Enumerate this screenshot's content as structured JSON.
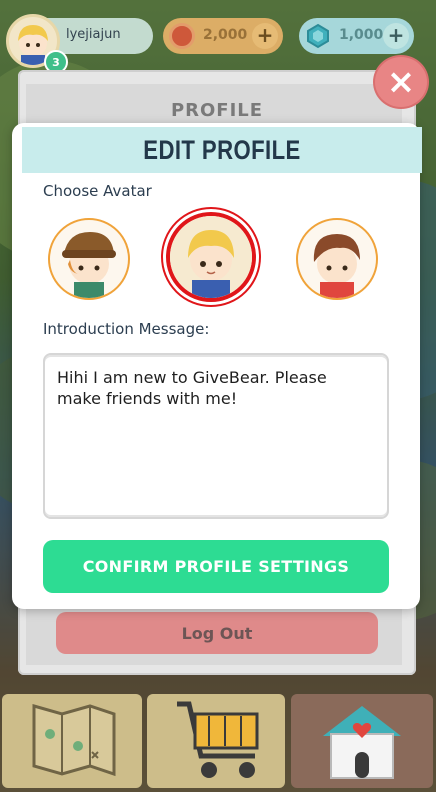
{
  "topbar": {
    "username": "lyejiajun",
    "level": "3",
    "coins": "2,000",
    "gems": "1,000",
    "plus_label": "+",
    "coin_icon": "coin-icon",
    "gem_icon": "gem-icon"
  },
  "profile_panel": {
    "title": "PROFILE",
    "logout_label": "Log Out"
  },
  "modal": {
    "title": "EDIT PROFILE",
    "choose_avatar_label": "Choose Avatar",
    "avatars": [
      {
        "name": "avatar-hat-boy",
        "selected": false
      },
      {
        "name": "avatar-blonde-boy",
        "selected": true
      },
      {
        "name": "avatar-brown-hair-boy",
        "selected": false
      }
    ],
    "intro_label": "Introduction Message:",
    "intro_value": "Hihi I am new to GiveBear. Please make friends with me!",
    "confirm_label": "CONFIRM PROFILE SETTINGS"
  },
  "close_label": "×",
  "nav": {
    "items": [
      {
        "icon": "map-icon"
      },
      {
        "icon": "shopping-cart-icon"
      },
      {
        "icon": "home-heart-icon"
      }
    ]
  },
  "colors": {
    "accent": "#2ddc93",
    "header_bg": "#c8ecec",
    "selected_ring": "#e0161a",
    "logout": "#df8a8a"
  }
}
